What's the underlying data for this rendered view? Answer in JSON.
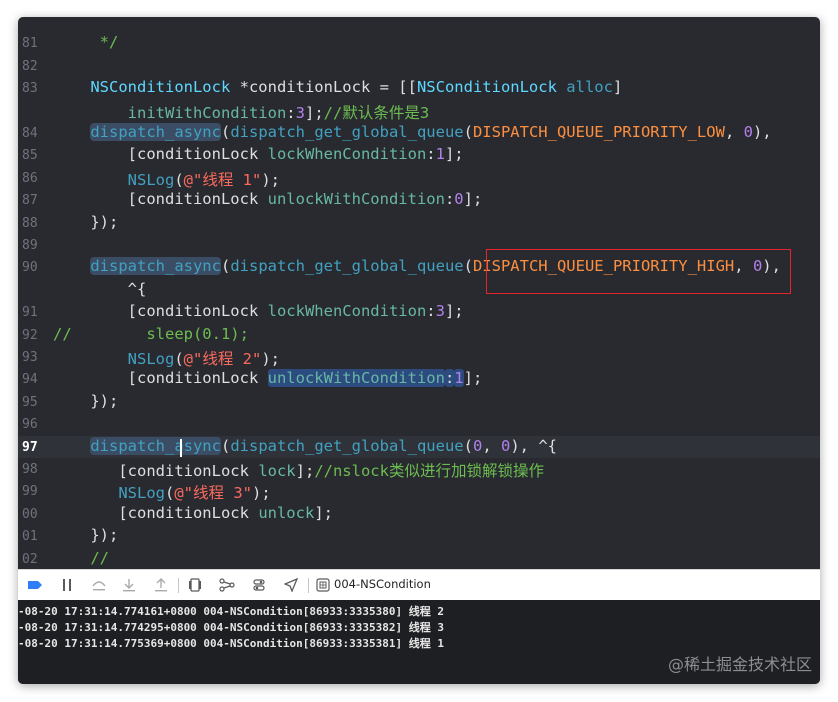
{
  "editor": {
    "lines": [
      {
        "num": "",
        "indent": 0,
        "tokens": [
          {
            "t": "          ",
            "c": ""
          }
        ]
      },
      {
        "num": "81",
        "indent": 0,
        "tokens": [
          {
            "t": "     */",
            "c": "kw-green"
          }
        ]
      },
      {
        "num": "82",
        "indent": 0,
        "tokens": []
      },
      {
        "num": "83",
        "indent": 0,
        "tokens": [
          {
            "t": "    ",
            "c": ""
          },
          {
            "t": "NSConditionLock",
            "c": "kw-type"
          },
          {
            "t": " *conditionLock = [[",
            "c": ""
          },
          {
            "t": "NSConditionLock",
            "c": "kw-type"
          },
          {
            "t": " ",
            "c": ""
          },
          {
            "t": "alloc",
            "c": "kw-fn"
          },
          {
            "t": "]",
            "c": ""
          }
        ]
      },
      {
        "num": "",
        "indent": 0,
        "tokens": [
          {
            "t": "        ",
            "c": ""
          },
          {
            "t": "initWithCondition",
            "c": "kw-attr"
          },
          {
            "t": ":",
            "c": ""
          },
          {
            "t": "3",
            "c": "kw-pink"
          },
          {
            "t": "];",
            "c": ""
          },
          {
            "t": "//默认条件是3",
            "c": "kw-green"
          }
        ]
      },
      {
        "num": "84",
        "indent": 0,
        "tokens": [
          {
            "t": "    ",
            "c": ""
          },
          {
            "t": "dispatch_async",
            "c": "kw-fn hl"
          },
          {
            "t": "(",
            "c": ""
          },
          {
            "t": "dispatch_get_global_queue",
            "c": "kw-fn"
          },
          {
            "t": "(",
            "c": ""
          },
          {
            "t": "DISPATCH_QUEUE_PRIORITY_LOW",
            "c": "kw-macro"
          },
          {
            "t": ", ",
            "c": ""
          },
          {
            "t": "0",
            "c": "kw-pink"
          },
          {
            "t": "),",
            "c": ""
          }
        ]
      },
      {
        "num": "85",
        "indent": 0,
        "tokens": [
          {
            "t": "        [conditionLock ",
            "c": ""
          },
          {
            "t": "lockWhenCondition",
            "c": "kw-attr"
          },
          {
            "t": ":",
            "c": ""
          },
          {
            "t": "1",
            "c": "kw-pink"
          },
          {
            "t": "];",
            "c": ""
          }
        ]
      },
      {
        "num": "86",
        "indent": 0,
        "tokens": [
          {
            "t": "        ",
            "c": ""
          },
          {
            "t": "NSLog",
            "c": "kw-fn"
          },
          {
            "t": "(",
            "c": ""
          },
          {
            "t": "@\"线程 1\"",
            "c": "kw-str"
          },
          {
            "t": ");",
            "c": ""
          }
        ]
      },
      {
        "num": "87",
        "indent": 0,
        "tokens": [
          {
            "t": "        [conditionLock ",
            "c": ""
          },
          {
            "t": "unlockWithCondition",
            "c": "kw-attr"
          },
          {
            "t": ":",
            "c": ""
          },
          {
            "t": "0",
            "c": "kw-pink"
          },
          {
            "t": "];",
            "c": ""
          }
        ]
      },
      {
        "num": "88",
        "indent": 0,
        "tokens": [
          {
            "t": "    });",
            "c": ""
          }
        ]
      },
      {
        "num": "89",
        "indent": 0,
        "tokens": []
      },
      {
        "num": "90",
        "indent": 0,
        "tokens": [
          {
            "t": "    ",
            "c": ""
          },
          {
            "t": "dispatch_async",
            "c": "kw-fn hl"
          },
          {
            "t": "(",
            "c": ""
          },
          {
            "t": "dispatch_get_global_queue",
            "c": "kw-fn"
          },
          {
            "t": "(",
            "c": ""
          },
          {
            "t": "DISPATCH_QUEUE_PRIORITY_HIGH",
            "c": "kw-macro"
          },
          {
            "t": ", ",
            "c": ""
          },
          {
            "t": "0",
            "c": "kw-pink"
          },
          {
            "t": "),",
            "c": ""
          }
        ]
      },
      {
        "num": "",
        "indent": 0,
        "tokens": [
          {
            "t": "        ^{",
            "c": ""
          }
        ]
      },
      {
        "num": "91",
        "indent": 0,
        "tokens": [
          {
            "t": "        [conditionLock ",
            "c": ""
          },
          {
            "t": "lockWhenCondition",
            "c": "kw-attr"
          },
          {
            "t": ":",
            "c": ""
          },
          {
            "t": "3",
            "c": "kw-pink"
          },
          {
            "t": "];",
            "c": ""
          }
        ]
      },
      {
        "num": "92",
        "indent": 0,
        "tokens": [
          {
            "t": "//        sleep(0.1);",
            "c": "kw-green"
          }
        ]
      },
      {
        "num": "93",
        "indent": 0,
        "tokens": [
          {
            "t": "        ",
            "c": ""
          },
          {
            "t": "NSLog",
            "c": "kw-fn"
          },
          {
            "t": "(",
            "c": ""
          },
          {
            "t": "@\"线程 2\"",
            "c": "kw-str"
          },
          {
            "t": ");",
            "c": ""
          }
        ]
      },
      {
        "num": "94",
        "indent": 0,
        "tokens": [
          {
            "t": "        [conditionLock ",
            "c": ""
          },
          {
            "t": "unlockWithCondition",
            "c": "kw-attr hl-sel"
          },
          {
            "t": ":",
            "c": "hl-sel"
          },
          {
            "t": "1",
            "c": "kw-pink hl-sel"
          },
          {
            "t": "];",
            "c": ""
          }
        ]
      },
      {
        "num": "95",
        "indent": 0,
        "tokens": [
          {
            "t": "    });",
            "c": ""
          }
        ]
      },
      {
        "num": "96",
        "indent": 0,
        "tokens": []
      },
      {
        "num": "97",
        "indent": 0,
        "current": true,
        "tokens": [
          {
            "t": "    ",
            "c": ""
          },
          {
            "t": "dispatch_async",
            "c": "kw-fn hl"
          },
          {
            "t": "(",
            "c": ""
          },
          {
            "t": "dispatch_get_global_queue",
            "c": "kw-fn"
          },
          {
            "t": "(",
            "c": ""
          },
          {
            "t": "0",
            "c": "kw-pink"
          },
          {
            "t": ", ",
            "c": ""
          },
          {
            "t": "0",
            "c": "kw-pink"
          },
          {
            "t": "), ^{",
            "c": ""
          }
        ]
      },
      {
        "num": "98",
        "indent": 0,
        "tokens": [
          {
            "t": "       [conditionLock ",
            "c": ""
          },
          {
            "t": "lock",
            "c": "kw-attr"
          },
          {
            "t": "];",
            "c": ""
          },
          {
            "t": "//nslock类似进行加锁解锁操作",
            "c": "kw-green"
          }
        ]
      },
      {
        "num": "99",
        "indent": 0,
        "tokens": [
          {
            "t": "       ",
            "c": ""
          },
          {
            "t": "NSLog",
            "c": "kw-fn"
          },
          {
            "t": "(",
            "c": ""
          },
          {
            "t": "@\"线程 3\"",
            "c": "kw-str"
          },
          {
            "t": ");",
            "c": ""
          }
        ]
      },
      {
        "num": "00",
        "indent": 0,
        "tokens": [
          {
            "t": "       [conditionLock ",
            "c": ""
          },
          {
            "t": "unlock",
            "c": "kw-attr"
          },
          {
            "t": "];",
            "c": ""
          }
        ]
      },
      {
        "num": "01",
        "indent": 0,
        "tokens": [
          {
            "t": "    });",
            "c": ""
          }
        ]
      },
      {
        "num": "02",
        "indent": 0,
        "tokens": [
          {
            "t": "    //",
            "c": "kw-green"
          }
        ]
      }
    ]
  },
  "debug_bar": {
    "target": "004-NSCondition",
    "icons": [
      "breakpoint-toggle-icon",
      "pause-icon",
      "step-over-icon",
      "step-into-icon",
      "step-out-icon",
      "view-debugger-icon",
      "memory-graph-icon",
      "environment-overrides-icon",
      "location-icon",
      "scheme-icon"
    ]
  },
  "console": {
    "lines": [
      "-08-20 17:31:14.774161+0800 004-NSCondition[86933:3335380] 线程 2",
      "-08-20 17:31:14.774295+0800 004-NSCondition[86933:3335382] 线程 3",
      "-08-20 17:31:14.775369+0800 004-NSCondition[86933:3335381] 线程 1"
    ]
  },
  "watermark": "@稀土掘金技术社区",
  "colors": {
    "background": "#292a30",
    "type": "#5dd8ff",
    "function": "#41a1c0",
    "attribute": "#67b7a4",
    "macro": "#fd8f3f",
    "number": "#b281eb",
    "string": "#fc6a5d",
    "comment": "#6bbd50",
    "highlight_box": "#e0262f"
  }
}
